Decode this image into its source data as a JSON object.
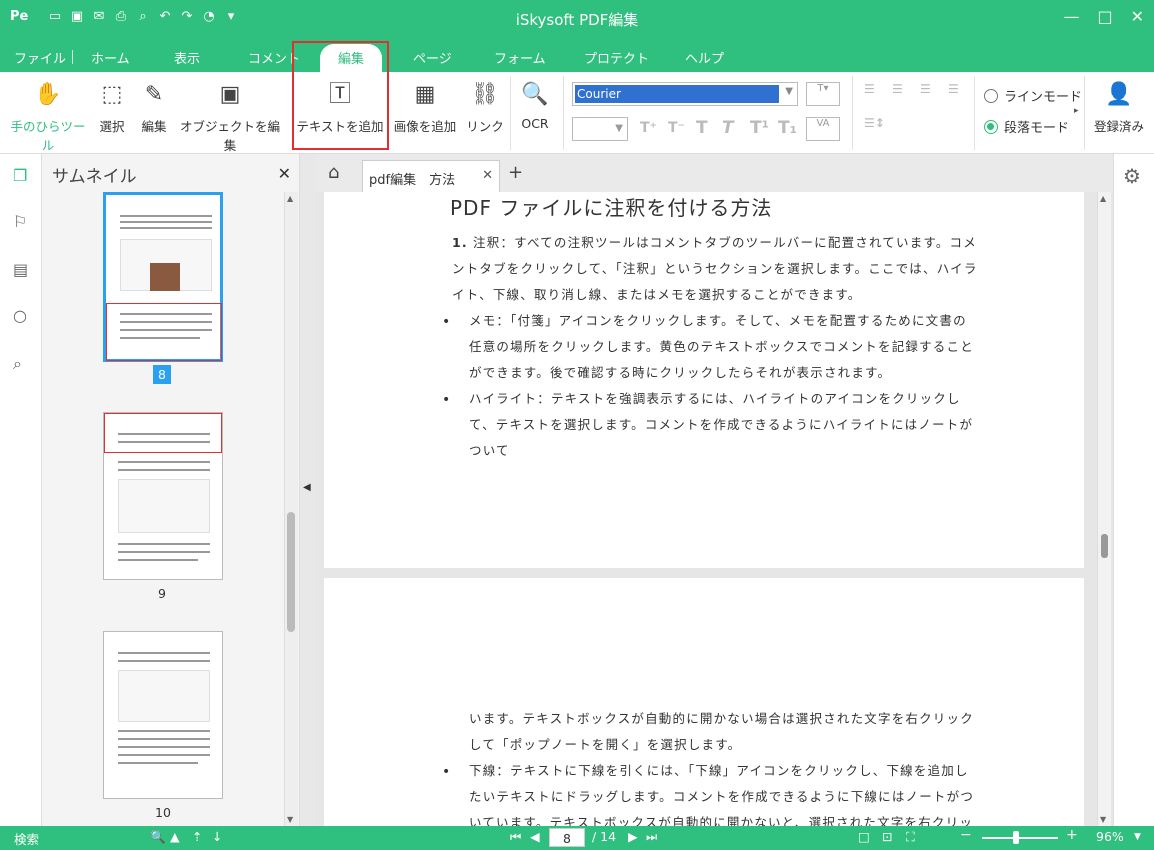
{
  "app": {
    "logo": "Pe",
    "title": "iSkysoft PDF編集"
  },
  "quick_access": [
    "folder-icon",
    "save-icon",
    "mail-icon",
    "print-icon",
    "preview-icon",
    "undo-icon",
    "redo-icon",
    "history-icon",
    "menu-icon"
  ],
  "window_controls": {
    "minimize": "—",
    "maximize": "□",
    "close": "✕"
  },
  "tabs": [
    {
      "label": "ファイル"
    },
    {
      "label": "ホーム"
    },
    {
      "label": "表示"
    },
    {
      "label": "コメント"
    },
    {
      "label": "編集",
      "active": true
    },
    {
      "label": "ページ"
    },
    {
      "label": "フォーム"
    },
    {
      "label": "プロテクト"
    },
    {
      "label": "ヘルプ"
    }
  ],
  "ribbon": {
    "hand": "手のひらツール",
    "select": "選択",
    "edit": "編集",
    "edit_object": "オブジェクトを編集",
    "add_text": "テキストを追加",
    "add_image": "画像を追加",
    "link": "リンク",
    "ocr": "OCR",
    "font": "Courier",
    "line_mode": "ラインモード",
    "paragraph_mode": "段落モード",
    "registered": "登録済み"
  },
  "sidebar": {
    "title": "サムネイル",
    "close": "✕",
    "pages": [
      "8",
      "9",
      "10"
    ]
  },
  "doc_tab": {
    "label": "pdf編集　方法",
    "close": "✕",
    "add": "+"
  },
  "document": {
    "heading": "PDF ファイルに注釈を付ける方法",
    "p1_num": "1.",
    "p1": "注釈：すべての注釈ツールはコメントタブのツールバーに配置されています。コメントタブをクリックして、「注釈」というセクションを選択します。ここでは、ハイライト、下線、取り消し線、またはメモを選択することができます。",
    "b1": "メモ：「付箋」アイコンをクリックします。そして、メモを配置するために文書の任意の場所をクリックします。黄色のテキストボックスでコメントを記録することができます。後で確認する時にクリックしたらそれが表示されます。",
    "b2": "ハイライト：テキストを強調表示するには、ハイライトのアイコンをクリックして、テキストを選択します。コメントを作成できるようにハイライトにはノートがついて",
    "p2": "います。テキストボックスが自動的に開かない場合は選択された文字を右クリックして「ポップノートを開く」を選択します。",
    "b3": "下線：テキストに下線を引くには、「下線」アイコンをクリックし、下線を追加したいテキストにドラッグします。コメントを作成できるように下線にはノートがついています。テキストボックスが自動的に開かないと、選択された文字を右クリックして"
  },
  "status": {
    "search": "検索",
    "page": "8",
    "total": "/ 14",
    "zoom": "96%",
    "minus": "−",
    "plus": "+"
  }
}
